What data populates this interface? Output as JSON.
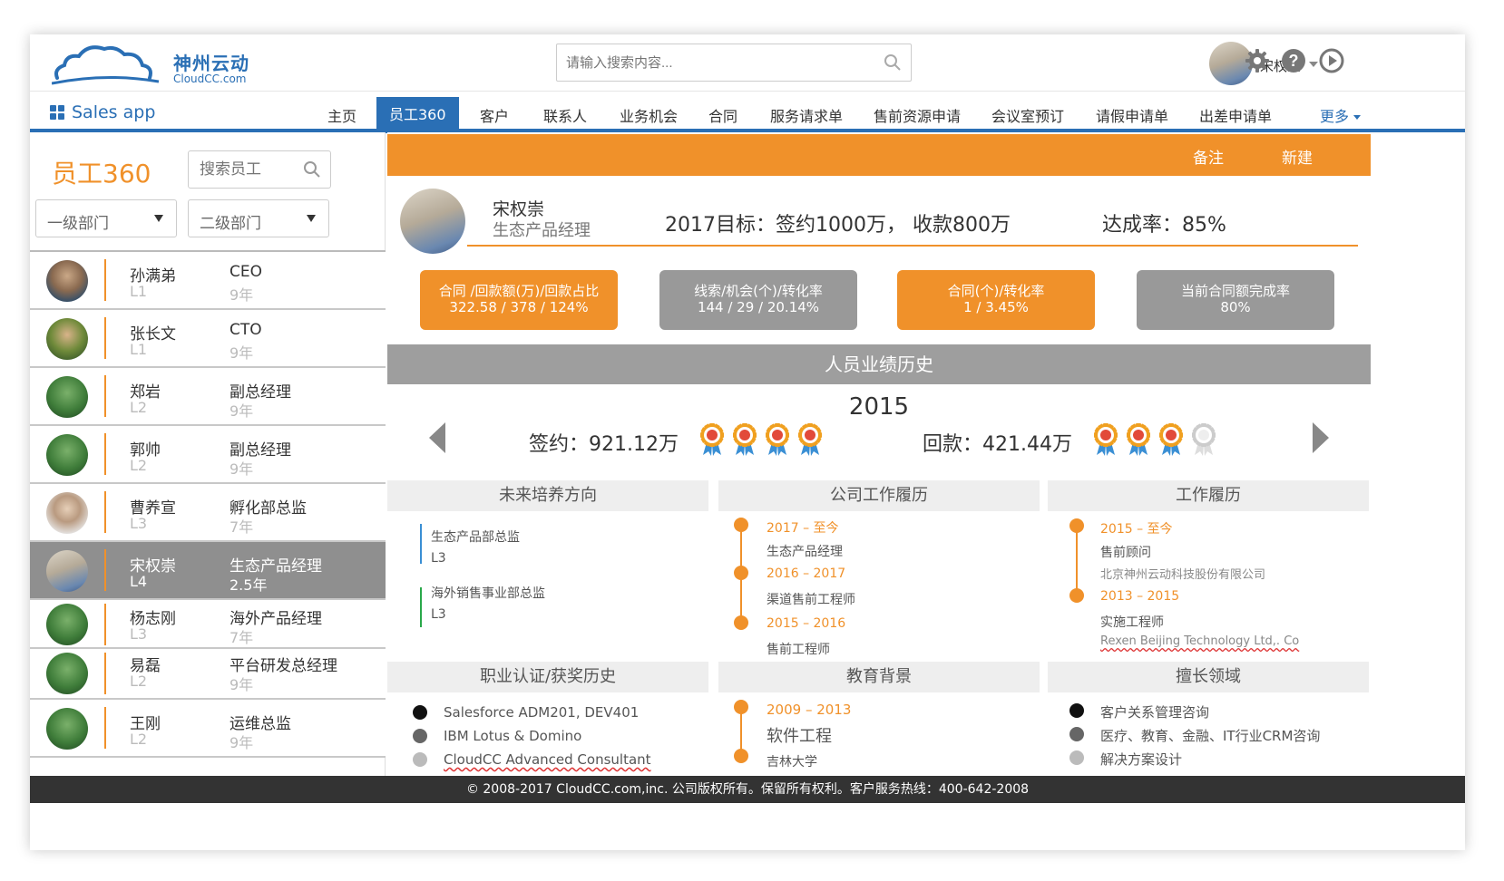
{
  "header": {
    "logo_cn": "神州云动",
    "logo_en": "CloudCC.com",
    "search_placeholder": "请输入搜索内容...",
    "user_name": "宋权崇"
  },
  "nav": {
    "app_name": "Sales app",
    "tabs": [
      "主页",
      "员工360",
      "客户",
      "联系人",
      "业务机会",
      "合同",
      "服务请求单",
      "售前资源申请",
      "会议室预订",
      "请假申请单",
      "出差申请单"
    ],
    "active_tab": "员工360",
    "more": "更多"
  },
  "sidebar": {
    "title": "员工360",
    "search_placeholder": "搜索员工",
    "dept1": "一级部门",
    "dept2": "二级部门",
    "employees": [
      {
        "name": "孙满弟",
        "level": "L1",
        "title": "CEO",
        "years": "9年"
      },
      {
        "name": "张长文",
        "level": "L1",
        "title": "CTO",
        "years": "9年"
      },
      {
        "name": "郑岩",
        "level": "L2",
        "title": "副总经理",
        "years": "9年"
      },
      {
        "name": "郭帅",
        "level": "L2",
        "title": "副总经理",
        "years": "9年"
      },
      {
        "name": "曹养宣",
        "level": "L3",
        "title": "孵化部总监",
        "years": "7年"
      },
      {
        "name": "宋权崇",
        "level": "L4",
        "title": "生态产品经理",
        "years": "2.5年"
      },
      {
        "name": "杨志刚",
        "level": "L3",
        "title": "海外产品经理",
        "years": "7年"
      },
      {
        "name": "易磊",
        "level": "L2",
        "title": "平台研发总经理",
        "years": "9年"
      },
      {
        "name": "王刚",
        "level": "L2",
        "title": "运维总监",
        "years": "9年"
      }
    ]
  },
  "main": {
    "actions": {
      "note": "备注",
      "new": "新建"
    },
    "profile": {
      "name": "宋权崇",
      "title": "生态产品经理",
      "goal": "2017目标：签约1000万， 收款800万",
      "rate": "达成率：85%"
    },
    "kpis": [
      {
        "label": "合同 /回款额(万)/回款占比",
        "value": "322.58 / 378 / 124%",
        "color": "#f0912a"
      },
      {
        "label": "线索/机会(个)/转化率",
        "value": "144 / 29 / 20.14%",
        "color": "#999999"
      },
      {
        "label": "合同(个)/转化率",
        "value": "1  /  3.45%",
        "color": "#f0912a"
      },
      {
        "label": "当前合同额完成率",
        "value": "80%",
        "color": "#999999"
      }
    ],
    "history": {
      "heading": "人员业绩历史",
      "year": "2015",
      "sign": "签约：921.12万",
      "sign_medals": 4,
      "pay": "回款：421.44万",
      "pay_medals": 3,
      "pay_medals_total": 4
    },
    "future": {
      "heading": "未来培养方向",
      "items": [
        {
          "title": "生态产品部总监",
          "level": "L3",
          "color": "#3a8fd4"
        },
        {
          "title": "海外销售事业部总监",
          "level": "L3",
          "color": "#2aa84a"
        }
      ]
    },
    "company_history": {
      "heading": "公司工作履历",
      "items": [
        {
          "period": "2017 – 至今",
          "role": "生态产品经理"
        },
        {
          "period": "2016 – 2017",
          "role": "渠道售前工程师"
        },
        {
          "period": "2015 – 2016",
          "role": "售前工程师"
        }
      ]
    },
    "work_history": {
      "heading": "工作履历",
      "items": [
        {
          "period": "2015 – 至今",
          "role": "售前顾问",
          "company": "北京神州云动科技股份有限公司"
        },
        {
          "period": "2013 – 2015",
          "role": "实施工程师",
          "company": "Rexen Beijing Technology Ltd,. Co"
        }
      ]
    },
    "certs": {
      "heading": "职业认证/获奖历史",
      "items": [
        "Salesforce ADM201, DEV401",
        "IBM Lotus & Domino",
        "CloudCC Advanced Consultant"
      ]
    },
    "education": {
      "heading": "教育背景",
      "period": "2009 – 2013",
      "major": "软件工程",
      "school": "吉林大学"
    },
    "expertise": {
      "heading": "擅长领域",
      "items": [
        "客户关系管理咨询",
        "医疗、教育、金融、IT行业CRM咨询",
        "解决方案设计"
      ]
    }
  },
  "footer": "© 2008-2017 CloudCC.com,inc. 公司版权所有。保留所有权利。客户服务热线：400-642-2008"
}
